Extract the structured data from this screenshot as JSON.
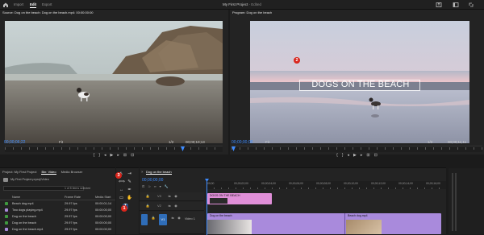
{
  "topbar": {
    "tabs": [
      "Import",
      "Edit",
      "Export"
    ],
    "active_tab": "Edit",
    "title": "My First Project",
    "title_sub": " - Edited"
  },
  "source": {
    "title": "Source: Dog on the beach: Dog on the beach.mp4: 00:00:00:00",
    "timecode": "00;00;06;22",
    "fit": "Fit",
    "res": "1/2",
    "duration": "00;00;10;13"
  },
  "program": {
    "title": "Program: Dog on the beach",
    "timecode": "00;00;00;00",
    "fit": "Fit",
    "res": "1/2",
    "duration": "00;00;11;11",
    "overlay_text": "DOGS ON THE BEACH"
  },
  "badges": [
    "1",
    "2",
    "3"
  ],
  "project": {
    "tabs": [
      "Project: My First Project",
      "Bin: Video",
      "Media Browser"
    ],
    "active_tab": "Bin: Video",
    "path": "My First Project.prproj\\Video",
    "selection": "1 of 5 items selected",
    "columns": {
      "name": "Name",
      "frame_rate": "Frame Rate",
      "media_start": "Media Start"
    },
    "rows": [
      {
        "name": "Beach dog.mp4",
        "frame_rate": "29.97 fps",
        "media_start": "00:00:01;14",
        "color": "#3f9a3f"
      },
      {
        "name": "Two dogs playing.mp4",
        "frame_rate": "29.97 fps",
        "media_start": "00:00:00;00",
        "color": "#a98adc"
      },
      {
        "name": "Dog on the beach",
        "frame_rate": "29.97 fps",
        "media_start": "00:00:00;00",
        "color": "#3f9a3f"
      },
      {
        "name": "Dog on the beach",
        "frame_rate": "29.97 fps",
        "media_start": "00:00:00;00",
        "color": "#3f9a3f"
      },
      {
        "name": "Dog on the beach.mp4",
        "frame_rate": "29.97 fps",
        "media_start": "00:00:00;00",
        "color": "#a98adc"
      }
    ]
  },
  "timeline": {
    "title": "Dog on the beach",
    "timecode": "00;00;00;00",
    "ruler_labels": [
      ";00;00",
      "00;00;02;00",
      "00;00;04;00",
      "00;00;06;00",
      "00;00;08;00",
      "00;00;10;00",
      "00;00;12;00",
      "00;00;14;00",
      "00;00;16;00"
    ],
    "tracks": [
      "V3",
      "V2",
      "V1"
    ],
    "v1_name": "Video 1",
    "clips": [
      {
        "label": "DOGS ON THE BEACH"
      },
      {
        "label": "Dog on the beach"
      },
      {
        "label": "Beach dog.mp4"
      }
    ]
  },
  "colors": {
    "accent": "#3d8bff",
    "marker": "#d9251c",
    "clip_pink": "#e08fd8",
    "clip_purple": "#a98adc"
  }
}
